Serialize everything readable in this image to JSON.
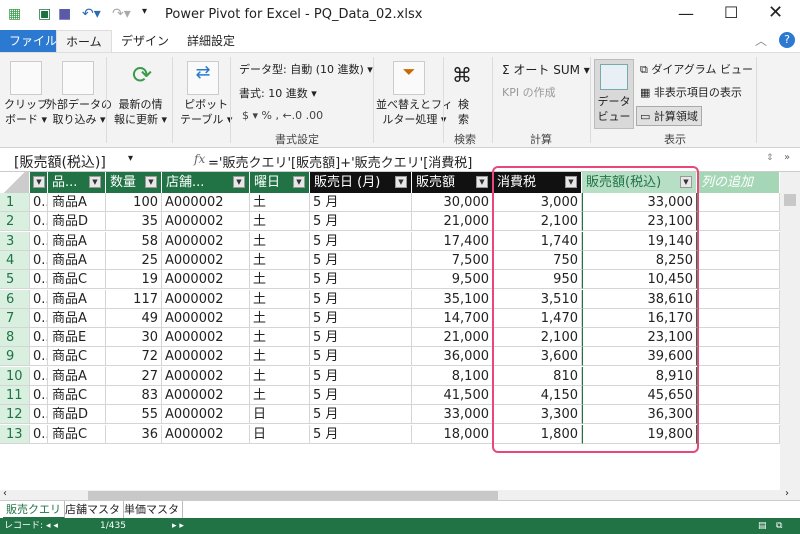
{
  "title": "Power Pivot for Excel - PQ_Data_02.xlsx",
  "ribbon_tabs": [
    "ファイル",
    "ホーム",
    "デザイン",
    "詳細設定"
  ],
  "ribbon": {
    "clipboard": "クリップ\nボード ▾",
    "external": "外部データの\n取り込み ▾",
    "refresh": "最新の情\n報に更新 ▾",
    "pivot": "ピボット\nテーブル ▾",
    "datatype": "データ型: 自動 (10 進数) ▾",
    "format": "書式: 10 進数 ▾",
    "numfmt": "$ ▾  %  ,  ←.0  .00",
    "group_format": "書式設定",
    "sortfilter": "並べ替えとフィ\nルター処理 ▾",
    "find": "検\n索",
    "group_find": "検索",
    "autosum": "Σ オート SUM ▾",
    "kpi": "KPI の作成",
    "group_calc": "計算",
    "dataview": "データ\nビュー",
    "diagram": "ダイアグラム ビュー",
    "hidden": "非表示項目の表示",
    "calcarea": "計算領域",
    "group_view": "表示"
  },
  "formula": {
    "name_box": "[販売額(税込)]",
    "fx": "fx",
    "text": "='販売クエリ'[販売額]+'販売クエリ'[消費税]"
  },
  "columns": [
    "",
    "品...",
    "数量",
    "店舗...",
    "曜日",
    "販売日 (月)",
    "販売額",
    "消費税",
    "販売額(税込)",
    "列の追加"
  ],
  "rows": [
    [
      "1",
      "0...",
      "商品A",
      "100",
      "A000002",
      "土",
      "5 月",
      "30,000",
      "3,000",
      "33,000"
    ],
    [
      "2",
      "0...",
      "商品D",
      "35",
      "A000002",
      "土",
      "5 月",
      "21,000",
      "2,100",
      "23,100"
    ],
    [
      "3",
      "0...",
      "商品A",
      "58",
      "A000002",
      "土",
      "5 月",
      "17,400",
      "1,740",
      "19,140"
    ],
    [
      "4",
      "0...",
      "商品A",
      "25",
      "A000002",
      "土",
      "5 月",
      "7,500",
      "750",
      "8,250"
    ],
    [
      "5",
      "0...",
      "商品C",
      "19",
      "A000002",
      "土",
      "5 月",
      "9,500",
      "950",
      "10,450"
    ],
    [
      "6",
      "0...",
      "商品A",
      "117",
      "A000002",
      "土",
      "5 月",
      "35,100",
      "3,510",
      "38,610"
    ],
    [
      "7",
      "0...",
      "商品A",
      "49",
      "A000002",
      "土",
      "5 月",
      "14,700",
      "1,470",
      "16,170"
    ],
    [
      "8",
      "0...",
      "商品E",
      "30",
      "A000002",
      "土",
      "5 月",
      "21,000",
      "2,100",
      "23,100"
    ],
    [
      "9",
      "0...",
      "商品C",
      "72",
      "A000002",
      "土",
      "5 月",
      "36,000",
      "3,600",
      "39,600"
    ],
    [
      "10",
      "0...",
      "商品A",
      "27",
      "A000002",
      "土",
      "5 月",
      "8,100",
      "810",
      "8,910"
    ],
    [
      "11",
      "0...",
      "商品C",
      "83",
      "A000002",
      "土",
      "5 月",
      "41,500",
      "4,150",
      "45,650"
    ],
    [
      "12",
      "0...",
      "商品D",
      "55",
      "A000002",
      "日",
      "5 月",
      "33,000",
      "3,300",
      "36,300"
    ],
    [
      "13",
      "0...",
      "商品C",
      "36",
      "A000002",
      "日",
      "5 月",
      "18,000",
      "1,800",
      "19,800"
    ]
  ],
  "sheet_tabs": [
    "販売クエリ",
    "店舗マスタ",
    "単価マスタ"
  ],
  "status": {
    "record_label": "レコード:",
    "record": "1/435"
  },
  "colors": {
    "green": "#217346",
    "highlight": "#e8477a",
    "selected_header": "#b7dfc6"
  }
}
